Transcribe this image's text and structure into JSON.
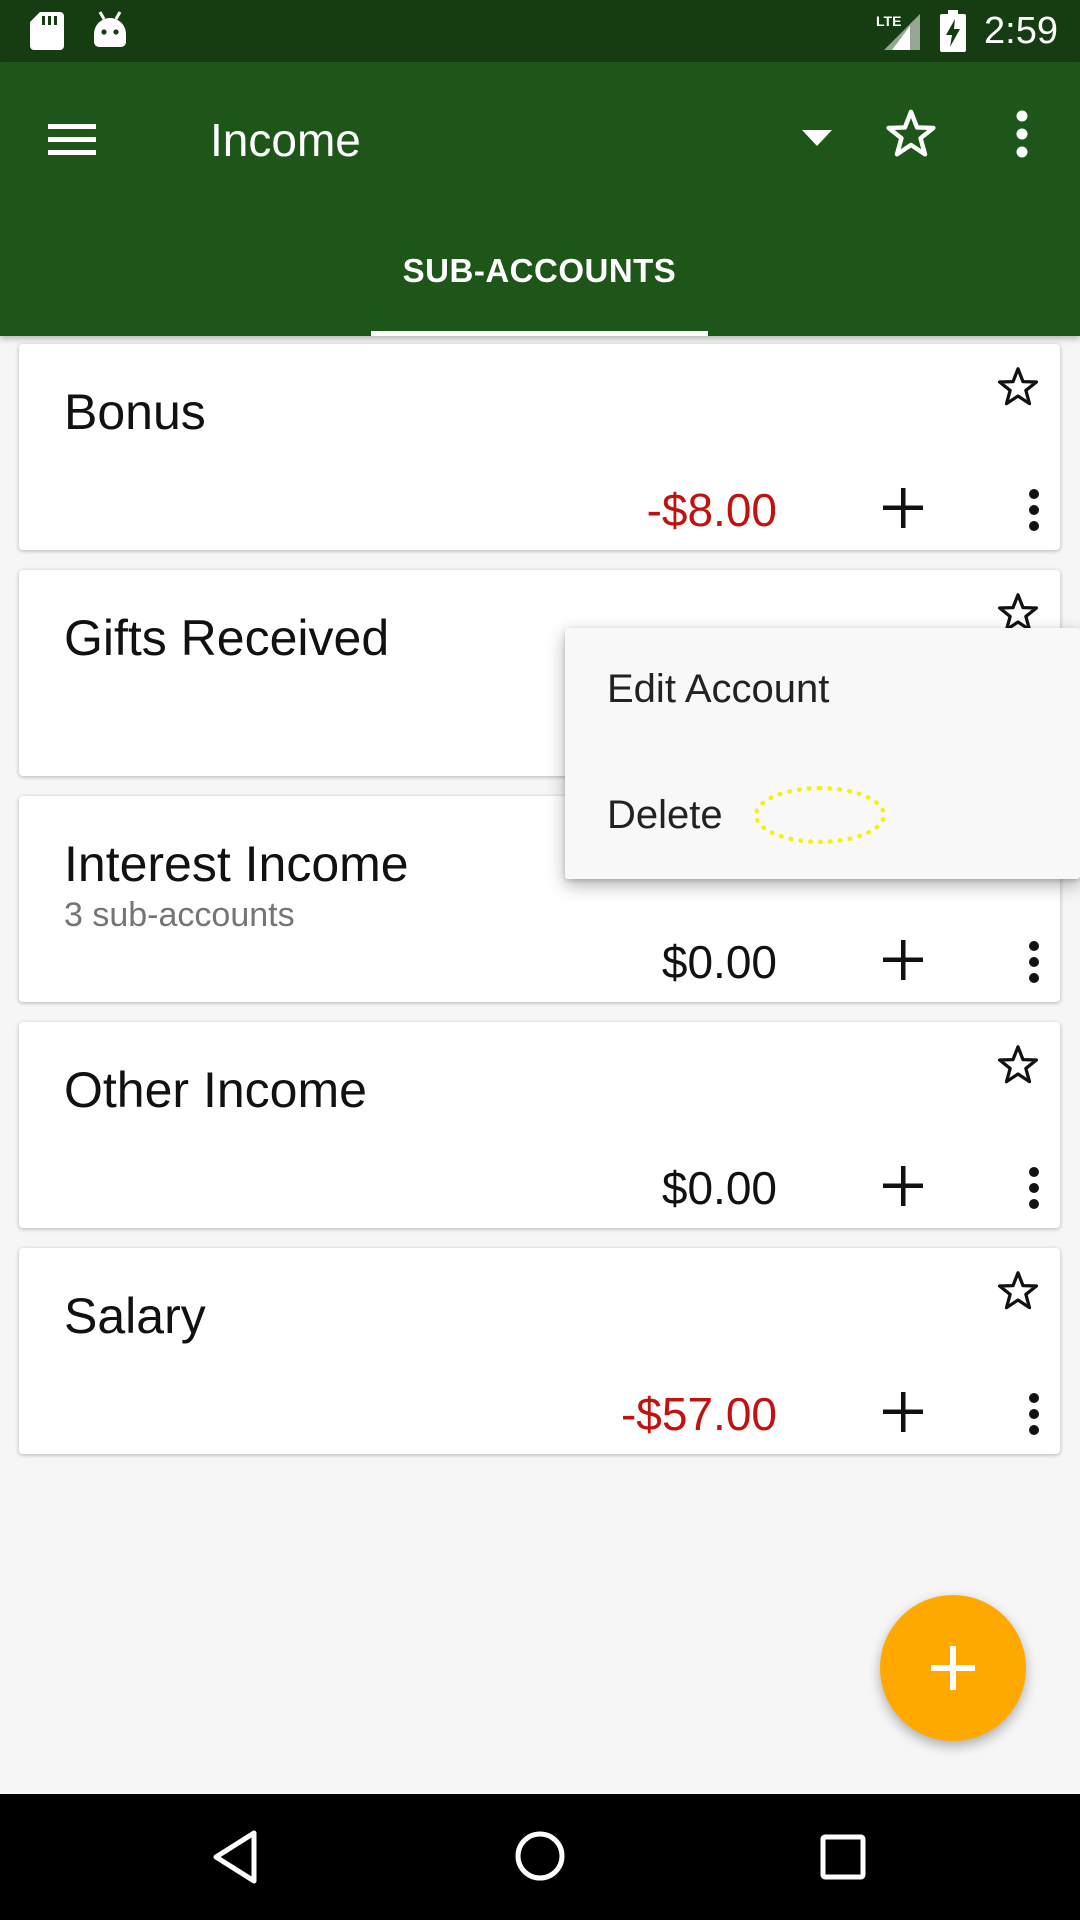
{
  "status_bar": {
    "time": "2:59",
    "network": "LTE",
    "icons": [
      "sd-card-icon",
      "android-icon",
      "signal-icon",
      "battery-charging-icon"
    ]
  },
  "app_bar": {
    "title": "Income",
    "background_color": "#1e561a",
    "icons": [
      "menu-icon",
      "dropdown-icon",
      "star-icon",
      "overflow-icon"
    ]
  },
  "tabs": [
    {
      "label": "SUB-ACCOUNTS",
      "selected": true
    }
  ],
  "accounts": [
    {
      "name": "Bonus",
      "subtitle": "",
      "balance": "-$8.00",
      "negative": true
    },
    {
      "name": "Gifts Received",
      "subtitle": "",
      "balance": "",
      "negative": false
    },
    {
      "name": "Interest Income",
      "subtitle": "3 sub-accounts",
      "balance": "$0.00",
      "negative": false
    },
    {
      "name": "Other Income",
      "subtitle": "",
      "balance": "$0.00",
      "negative": false
    },
    {
      "name": "Salary",
      "subtitle": "",
      "balance": "-$57.00",
      "negative": true
    }
  ],
  "popup_menu": {
    "items": [
      {
        "label": "Edit Account"
      },
      {
        "label": "Delete"
      }
    ]
  },
  "colors": {
    "status_bar": "#163c12",
    "app_bar": "#1e561a",
    "negative_amount": "#c0120f",
    "fab": "#ffa900",
    "tap_marker": "#f2f20c"
  },
  "fab": {
    "icon": "plus-icon"
  },
  "nav_bar": {
    "icons": [
      "back-icon",
      "home-icon",
      "recents-icon"
    ]
  }
}
